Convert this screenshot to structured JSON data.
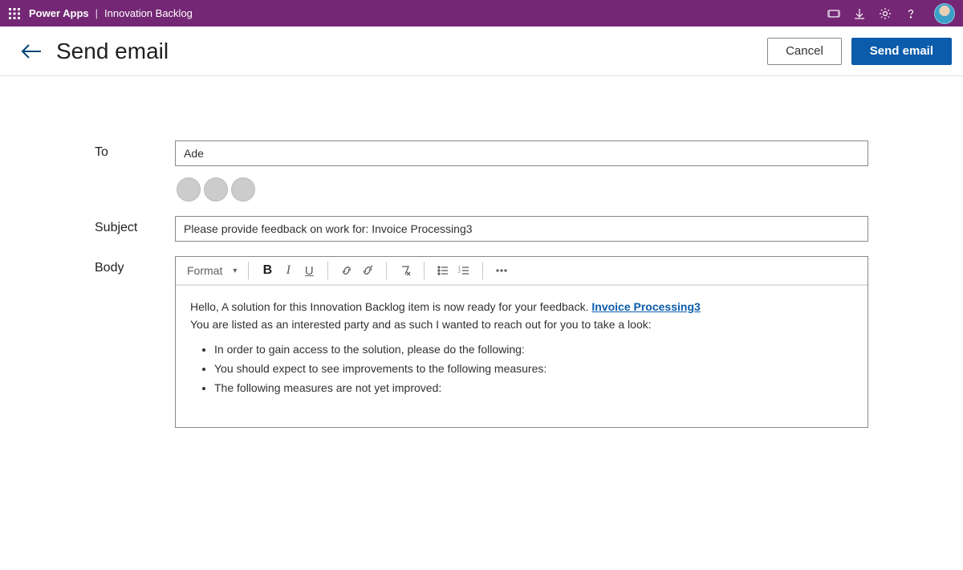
{
  "topbar": {
    "brand": "Power Apps",
    "separator": "|",
    "app_name": "Innovation Backlog"
  },
  "commandbar": {
    "page_title": "Send email",
    "cancel_label": "Cancel",
    "send_label": "Send email"
  },
  "form": {
    "labels": {
      "to": "To",
      "subject": "Subject",
      "body": "Body"
    },
    "to_value": "Ade",
    "subject_value": "Please provide feedback on work for: Invoice Processing3",
    "toolbar": {
      "format_label": "Format",
      "bold": "B",
      "italic": "I",
      "underline": "U"
    },
    "body": {
      "greeting_prefix": "Hello, A solution for this Innovation Backlog item is now ready for your feedback. ",
      "link_text": "Invoice Processing3",
      "line2": "You are listed as an interested party and as such I wanted to reach out for you to take a look:",
      "bullets": [
        "In order to gain access to the solution, please do the following:",
        "You should expect to see improvements to the following measures:",
        "The following measures are not yet improved:"
      ]
    }
  }
}
